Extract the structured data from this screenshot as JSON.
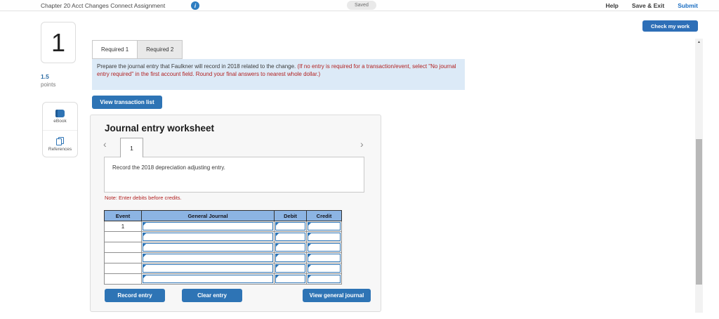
{
  "topbar": {
    "title": "Chapter 20 Acct Changes Connect Assignment",
    "saved_label": "Saved",
    "help_label": "Help",
    "save_exit_label": "Save & Exit",
    "submit_label": "Submit"
  },
  "check_my_work_label": "Check my work",
  "sidebar": {
    "question_number": "1",
    "points_value": "1.5",
    "points_label": "points",
    "ebook_label": "eBook",
    "references_label": "References"
  },
  "main": {
    "tabs": [
      {
        "label": "Required 1",
        "active": true
      },
      {
        "label": "Required 2",
        "active": false
      }
    ],
    "instruction_main": "Prepare the journal entry that Faulkner will record in 2018 related to the change. ",
    "instruction_warning": "(If no entry is required for a transaction/event, select \"No journal entry required\" in the first account field. Round your final answers to nearest whole dollar.)",
    "view_transaction_label": "View transaction list"
  },
  "worksheet": {
    "title": "Journal entry worksheet",
    "page_tab": "1",
    "description": "Record the 2018 depreciation adjusting entry.",
    "note": "Note: Enter debits before credits.",
    "table": {
      "headers": [
        "Event",
        "General Journal",
        "Debit",
        "Credit"
      ],
      "rows": [
        {
          "event": "1",
          "journal": "",
          "debit": "",
          "credit": ""
        },
        {
          "event": "",
          "journal": "",
          "debit": "",
          "credit": ""
        },
        {
          "event": "",
          "journal": "",
          "debit": "",
          "credit": ""
        },
        {
          "event": "",
          "journal": "",
          "debit": "",
          "credit": ""
        },
        {
          "event": "",
          "journal": "",
          "debit": "",
          "credit": ""
        },
        {
          "event": "",
          "journal": "",
          "debit": "",
          "credit": ""
        }
      ]
    },
    "buttons": {
      "record": "Record entry",
      "clear": "Clear entry",
      "view_general": "View general journal"
    }
  },
  "icons": {
    "info_glyph": "i",
    "prev_glyph": "‹",
    "next_glyph": "›",
    "scroll_up_glyph": "▲"
  },
  "colors": {
    "accent_blue": "#2e74b5",
    "table_header_blue": "#8cb4e3",
    "input_border_blue": "#2e75b6",
    "instruction_bg": "#dceaf7",
    "warning_red": "#b22222",
    "link_blue": "#1b6ec2"
  }
}
